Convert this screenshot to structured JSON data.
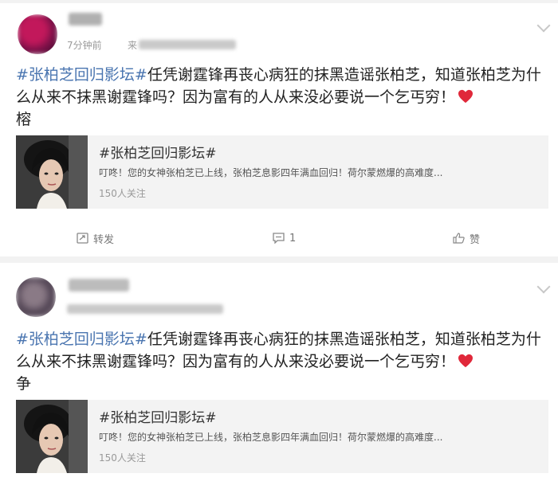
{
  "posts": [
    {
      "time": "7分钟前",
      "source_prefix": "来",
      "hashtag": "#张柏芝回归影坛#",
      "body": "任凭谢霆锋再丧心病狂的抹黑造谣张柏芝，知道张柏芝为什么从来不抹黑谢霆锋吗？因为富有的人从来没必要说一个乞丐穷！",
      "tail": "榕",
      "card": {
        "title": "#张柏芝回归影坛#",
        "desc": "叮咚！您的女神张柏芝已上线，张柏芝息影四年满血回归！荷尔蒙燃爆的高难度...",
        "followers": "150人关注"
      },
      "actions": {
        "repost": "转发",
        "comment": "1",
        "like": "赞"
      }
    },
    {
      "hashtag": "#张柏芝回归影坛#",
      "body": "任凭谢霆锋再丧心病狂的抹黑造谣张柏芝，知道张柏芝为什么从来不抹黑谢霆锋吗？因为富有的人从来没必要说一个乞丐穷！",
      "tail": "争",
      "card": {
        "title": "#张柏芝回归影坛#",
        "desc": "叮咚！您的女神张柏芝已上线，张柏芝息影四年满血回归！荷尔蒙燃爆的高难度...",
        "followers": "150人关注"
      }
    }
  ],
  "icons": {
    "more": "chevron-down-icon",
    "heart": "red-heart-emoji",
    "repost": "repost-icon",
    "comment": "comment-icon",
    "like": "thumbs-up-icon"
  },
  "colors": {
    "hashtag": "#4a75b0",
    "heart": "#e0283a",
    "background": "#f2f2f2",
    "card": "#f3f3f3"
  }
}
